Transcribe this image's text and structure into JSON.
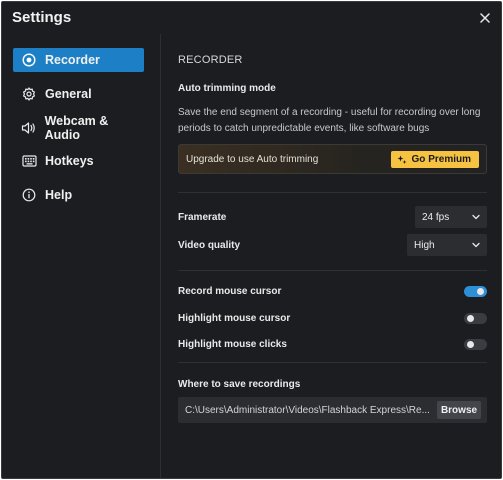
{
  "window": {
    "title": "Settings"
  },
  "sidebar": {
    "items": [
      {
        "label": "Recorder",
        "icon": "record-icon",
        "active": true
      },
      {
        "label": "General",
        "icon": "gear-icon",
        "active": false
      },
      {
        "label": "Webcam & Audio",
        "icon": "speaker-icon",
        "active": false
      },
      {
        "label": "Hotkeys",
        "icon": "keyboard-icon",
        "active": false
      },
      {
        "label": "Help",
        "icon": "info-icon",
        "active": false
      }
    ]
  },
  "recorder": {
    "section_title": "RECORDER",
    "auto_trim": {
      "label": "Auto trimming mode",
      "description": "Save the end segment of a recording - useful for recording over long periods to catch unpredictable events, like software bugs",
      "upgrade_text": "Upgrade to use Auto trimming",
      "premium_button": "Go Premium"
    },
    "framerate": {
      "label": "Framerate",
      "value": "24 fps"
    },
    "video_quality": {
      "label": "Video quality",
      "value": "High"
    },
    "toggles": [
      {
        "label": "Record mouse cursor",
        "on": true
      },
      {
        "label": "Highlight mouse cursor",
        "on": false
      },
      {
        "label": "Highlight mouse clicks",
        "on": false
      }
    ],
    "save_location": {
      "label": "Where to save recordings",
      "path": "C:\\Users\\Administrator\\Videos\\Flashback Express\\Re...",
      "browse_button": "Browse"
    }
  },
  "colors": {
    "background": "#1c1d21",
    "accent": "#1d80c6",
    "toggle_on": "#2d8fd6",
    "premium": "#f5c242"
  }
}
